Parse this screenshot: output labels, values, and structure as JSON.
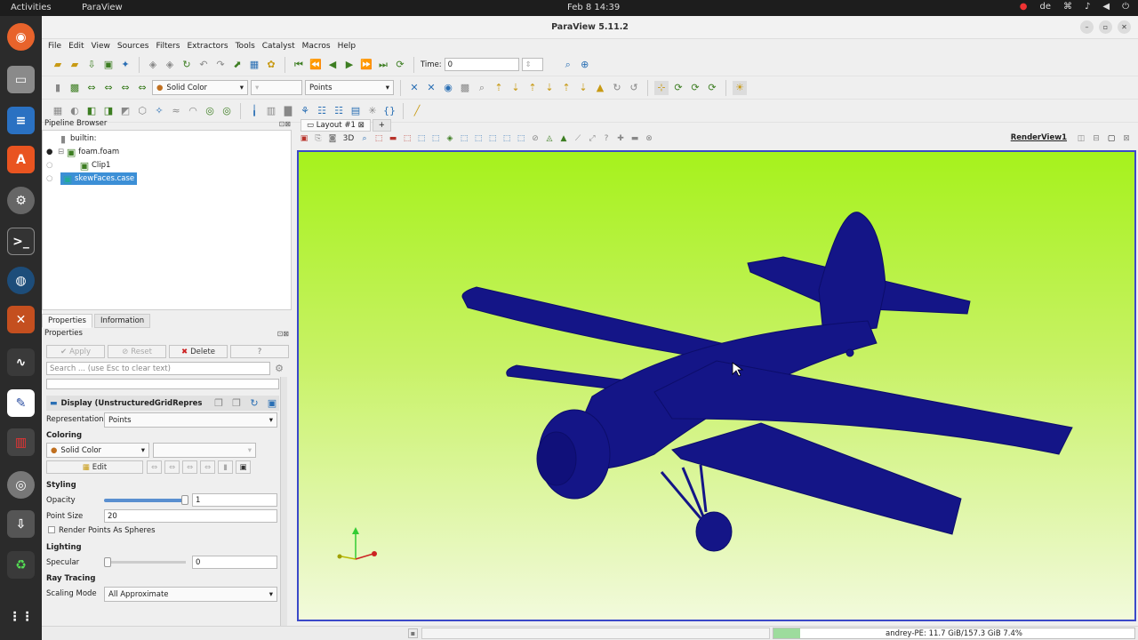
{
  "topbar": {
    "activities": "Activities",
    "app": "ParaView",
    "clock": "Feb 8  14:39",
    "lang": "de"
  },
  "window": {
    "title": "ParaView 5.11.2"
  },
  "menu": [
    "File",
    "Edit",
    "View",
    "Sources",
    "Filters",
    "Extractors",
    "Tools",
    "Catalyst",
    "Macros",
    "Help"
  ],
  "toolbar": {
    "time_label": "Time:",
    "time_value": "0",
    "color_combo": "Solid Color",
    "rep_combo": "Points"
  },
  "pipeline": {
    "title": "Pipeline Browser",
    "items": [
      "builtin:",
      "foam.foam",
      "Clip1",
      "skewFaces.case"
    ]
  },
  "tabs": {
    "properties": "Properties",
    "information": "Information"
  },
  "props": {
    "title": "Properties",
    "apply": "Apply",
    "reset": "Reset",
    "delete": "Delete",
    "help": "?",
    "search_placeholder": "Search ... (use Esc to clear text)",
    "display": "Display (UnstructuredGridRepres",
    "representation_label": "Representation",
    "representation_value": "Points",
    "coloring": "Coloring",
    "solid_color": "Solid Color",
    "edit": "Edit",
    "styling": "Styling",
    "opacity_label": "Opacity",
    "opacity_value": "1",
    "point_size_label": "Point Size",
    "point_size_value": "20",
    "spheres": "Render Points As Spheres",
    "lighting": "Lighting",
    "specular_label": "Specular",
    "specular_value": "0",
    "ray": "Ray Tracing",
    "scaling_label": "Scaling Mode",
    "scaling_value": "All Approximate"
  },
  "view": {
    "layout_tab": "Layout #1",
    "plus": "+",
    "threed": "3D",
    "render_view": "RenderView1"
  },
  "status": {
    "memory": "andrey-PE: 11.7 GiB/157.3 GiB 7.4%",
    "memory_fraction": 0.074
  },
  "colors": {
    "bg_top": "#a6f21c",
    "plane": "#141587"
  }
}
